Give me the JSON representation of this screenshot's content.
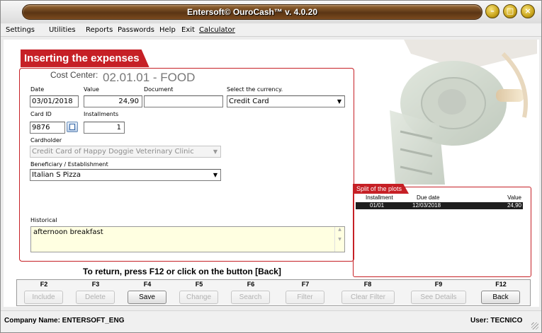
{
  "window": {
    "title": "Entersoft© OuroCash™ v. 4.0.20",
    "buttons": [
      "minimize",
      "maximize",
      "close"
    ]
  },
  "menu": {
    "items": [
      "Settings",
      "Utilities",
      "Reports",
      "Passwords",
      "Help",
      "Exit",
      "Calculator"
    ]
  },
  "form": {
    "section_title": "Inserting the expenses",
    "cost_center_label": "Cost Center:",
    "cost_center_value": "02.01.01 - FOOD",
    "date_label": "Date",
    "date_value": "03/01/2018",
    "value_label": "Value",
    "value_value": "24,90",
    "document_label": "Document",
    "document_value": "",
    "currency_label": "Select the currency.",
    "currency_value": "Credit Card",
    "card_id_label": "Card ID",
    "card_id_value": "9876",
    "installments_label": "Installments",
    "installments_value": "1",
    "cardholder_label": "Cardholder",
    "cardholder_value": "Credit Card of Happy Doggie Veterinary Clinic",
    "beneficiary_label": "Beneficiary / Establishment",
    "beneficiary_value": "Italian S Pizza",
    "historical_label": "Historical",
    "historical_value": "afternoon breakfast"
  },
  "split": {
    "title": "Split of the plots",
    "columns": [
      "Installment",
      "Due date",
      "Value"
    ],
    "rows": [
      {
        "installment": "01/01",
        "due_date": "12/03/2018",
        "value": "24,90"
      }
    ]
  },
  "hint": "To return, press F12 or click on the button [Back]",
  "function_keys": [
    {
      "key": "F2",
      "label": "Include",
      "enabled": false
    },
    {
      "key": "F3",
      "label": "Delete",
      "enabled": false
    },
    {
      "key": "F4",
      "label": "Save",
      "enabled": true
    },
    {
      "key": "F5",
      "label": "Change",
      "enabled": false
    },
    {
      "key": "F6",
      "label": "Search",
      "enabled": false
    },
    {
      "key": "F7",
      "label": "Filter",
      "enabled": false
    },
    {
      "key": "F8",
      "label": "Clear Filter",
      "enabled": false
    },
    {
      "key": "F9",
      "label": "See Details",
      "enabled": false
    },
    {
      "key": "F12",
      "label": "Back",
      "enabled": true
    }
  ],
  "status": {
    "company": "Company Name: ENTERSOFT_ENG",
    "user": "User: TECNICO"
  },
  "colors": {
    "accent_red": "#c62026",
    "title_bar_brown": "#5a3514",
    "window_button_gold": "#c9a41a",
    "historical_background": "#ffffe1"
  },
  "icons": {
    "card_lookup": "lookup-icon",
    "dropdown": "chevron-down-icon",
    "resize_grip": "resize-grip-icon"
  }
}
